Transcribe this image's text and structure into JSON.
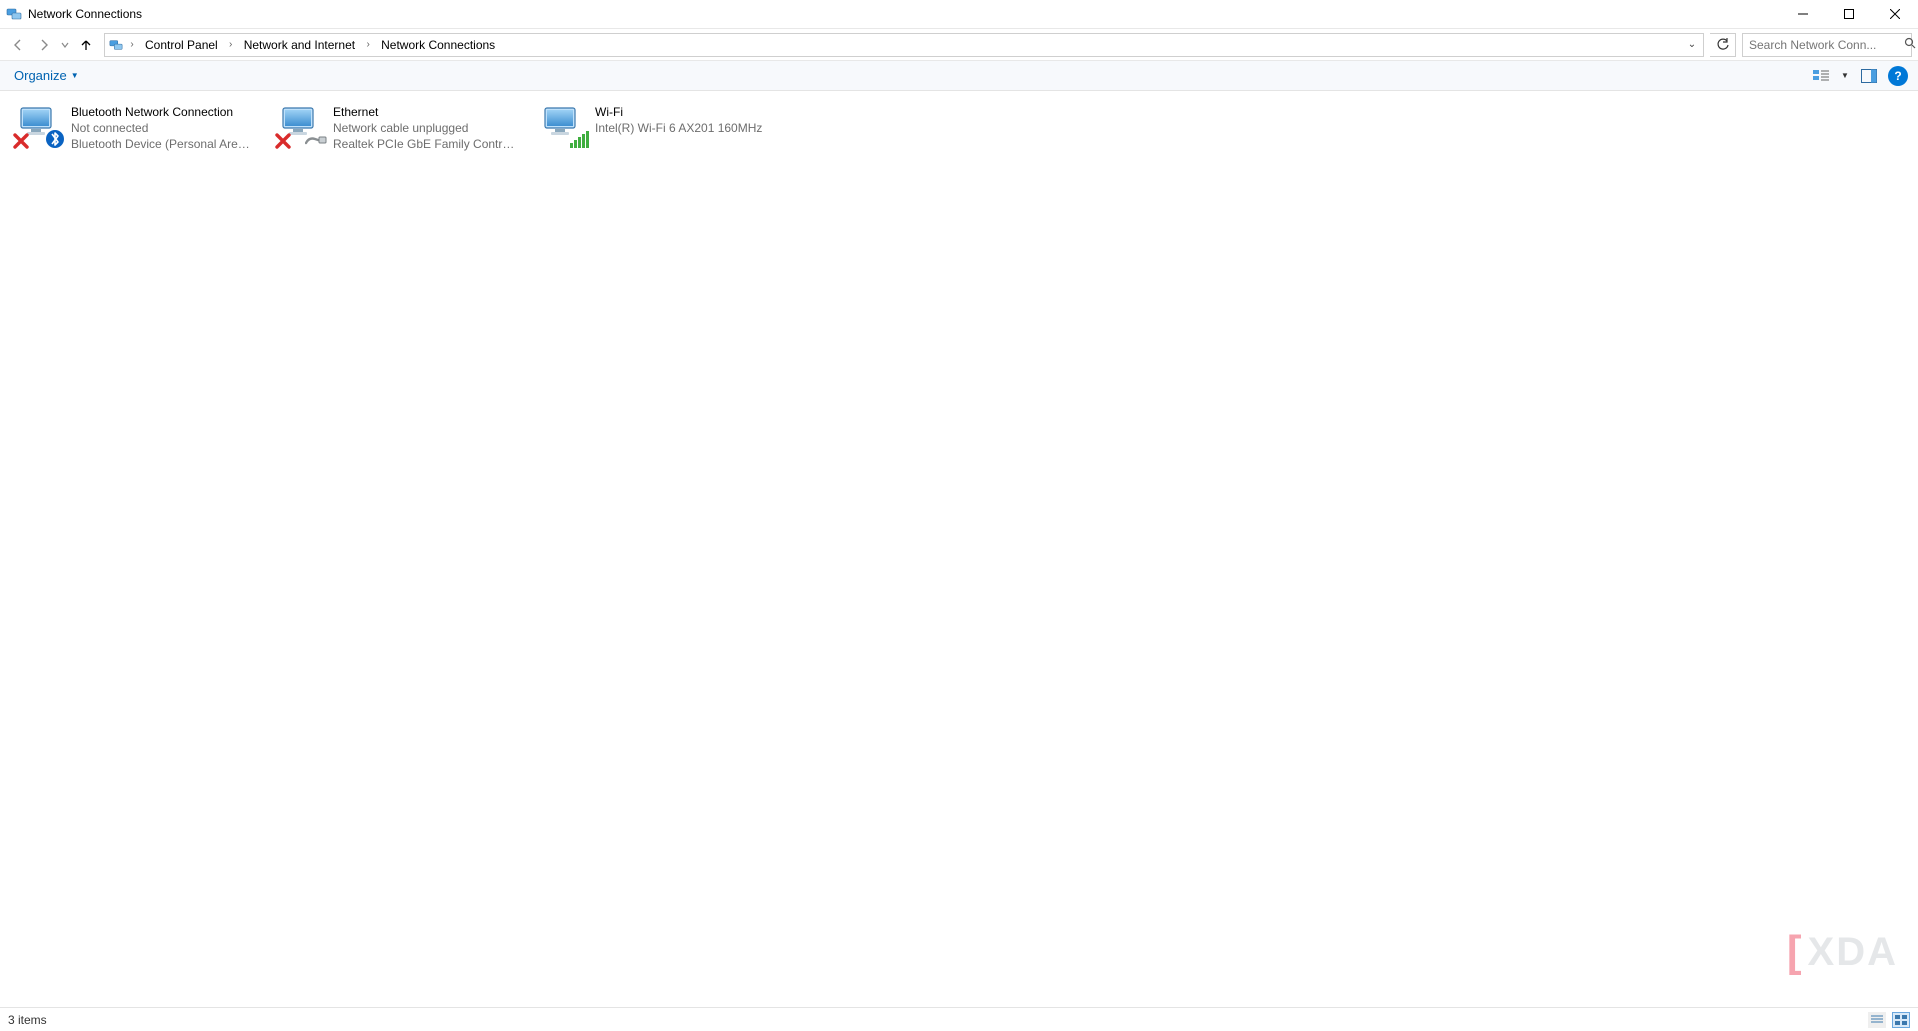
{
  "window": {
    "title": "Network Connections"
  },
  "breadcrumbs": {
    "items": [
      "Control Panel",
      "Network and Internet",
      "Network Connections"
    ]
  },
  "search": {
    "placeholder": "Search Network Conn..."
  },
  "commandbar": {
    "organize_label": "Organize"
  },
  "connections": [
    {
      "name": "Bluetooth Network Connection",
      "status": "Not connected",
      "device": "Bluetooth Device (Personal Area ...",
      "icon": "bluetooth",
      "disconnected": true
    },
    {
      "name": "Ethernet",
      "status": "Network cable unplugged",
      "device": "Realtek PCIe GbE Family Controller",
      "icon": "ethernet",
      "disconnected": true
    },
    {
      "name": "Wi-Fi",
      "status": "",
      "device": "Intel(R) Wi-Fi 6 AX201 160MHz",
      "icon": "wifi",
      "disconnected": false
    }
  ],
  "statusbar": {
    "item_count_label": "3 items"
  },
  "watermark": {
    "text": "XDA"
  }
}
